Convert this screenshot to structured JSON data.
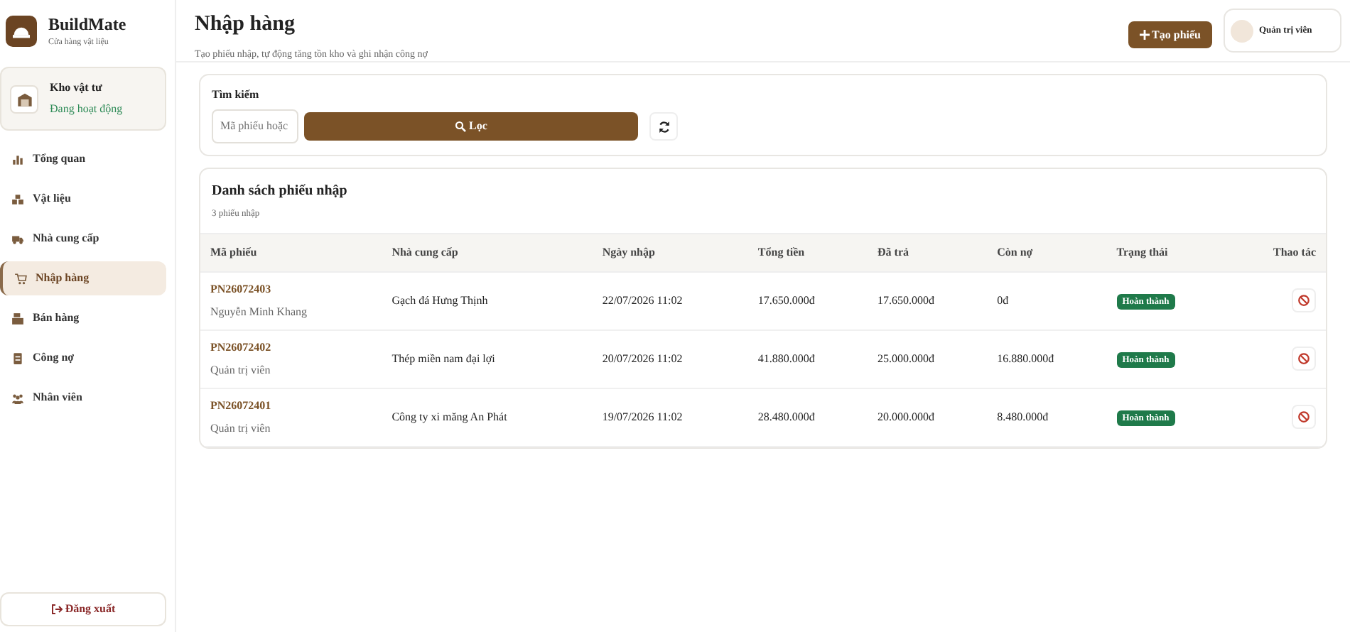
{
  "brand": {
    "name": "BuildMate",
    "tagline": "Cửa hàng vật liệu"
  },
  "store": {
    "name": "Kho vật tư",
    "status": "Đang hoạt động"
  },
  "nav": [
    {
      "label": "Tổng quan",
      "selected": false
    },
    {
      "label": "Vật liệu",
      "selected": false
    },
    {
      "label": "Nhà cung cấp",
      "selected": false
    },
    {
      "label": "Nhập hàng",
      "selected": true
    },
    {
      "label": "Bán hàng",
      "selected": false
    },
    {
      "label": "Công nợ",
      "selected": false
    },
    {
      "label": "Nhân viên",
      "selected": false
    }
  ],
  "logout": "Đăng xuất",
  "header": {
    "title": "Nhập hàng",
    "subtitle": "Tạo phiếu nhập, tự động tăng tồn kho và ghi nhận công nợ",
    "create_button": "Tạo phiếu",
    "user": "Quản trị viên"
  },
  "filter": {
    "label": "Tìm kiếm",
    "placeholder": "Mã phiếu hoặc",
    "button": "Lọc"
  },
  "list": {
    "title": "Danh sách phiếu nhập",
    "count": "3 phiếu nhập",
    "columns": [
      "Mã phiếu",
      "Nhà cung cấp",
      "Ngày nhập",
      "Tổng tiền",
      "Đã trả",
      "Còn nợ",
      "Trạng thái",
      "Thao tác"
    ],
    "rows": [
      {
        "code": "PN26072403",
        "creator": "Nguyễn Minh Khang",
        "supplier": "Gạch đá Hưng Thịnh",
        "date": "22/07/2026 11:02",
        "total": "17.650.000đ",
        "paid": "17.650.000đ",
        "debt": "0đ",
        "status": "Hoàn thành"
      },
      {
        "code": "PN26072402",
        "creator": "Quản trị viên",
        "supplier": "Thép miền nam đại lợi",
        "date": "20/07/2026 11:02",
        "total": "41.880.000đ",
        "paid": "25.000.000đ",
        "debt": "16.880.000đ",
        "status": "Hoàn thành"
      },
      {
        "code": "PN26072401",
        "creator": "Quản trị viên",
        "supplier": "Công ty xi măng An Phát",
        "date": "19/07/2026 11:02",
        "total": "28.480.000đ",
        "paid": "20.000.000đ",
        "debt": "8.480.000đ",
        "status": "Hoàn thành"
      }
    ]
  }
}
